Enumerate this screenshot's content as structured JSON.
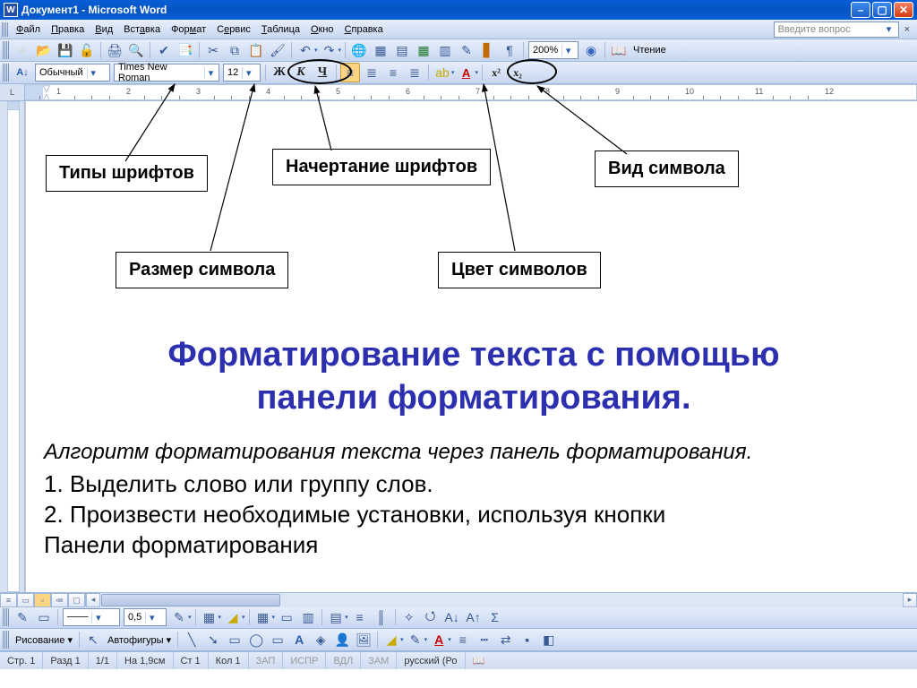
{
  "titlebar": {
    "title": "Документ1 - Microsoft Word"
  },
  "menu": {
    "items": [
      "Файл",
      "Правка",
      "Вид",
      "Вставка",
      "Формат",
      "Сервис",
      "Таблица",
      "Окно",
      "Справка"
    ],
    "question_placeholder": "Введите вопрос"
  },
  "toolbar1": {
    "zoom": "200%",
    "read_label": "Чтение"
  },
  "toolbar2": {
    "style": "Обычный",
    "font": "Times New Roman",
    "size": "12",
    "bold": "Ж",
    "italic": "К",
    "underline": "Ч",
    "sup": "x²",
    "sub": "x₂"
  },
  "ruler": {
    "numbers": [
      "1",
      "2",
      "3",
      "4",
      "5",
      "6",
      "7",
      "8",
      "9",
      "10",
      "11",
      "12"
    ]
  },
  "annotations": {
    "font_types": "Типы шрифтов",
    "font_style": "Начертание шрифтов",
    "symbol_kind": "Вид символа",
    "symbol_size": "Размер символа",
    "symbol_color": "Цвет символов"
  },
  "document": {
    "heading_line1": "Форматирование текста с помощью",
    "heading_line2": "панели форматирования.",
    "subtitle": "Алгоритм форматирования текста через панель форматирования.",
    "line1": "1. Выделить слово или группу слов.",
    "line2": "2. Произвести необходимые установки, используя кнопки",
    "line3": "Панели форматирования"
  },
  "bottom_toolbar": {
    "line_weight": "0,5"
  },
  "drawbar": {
    "label": "Рисование",
    "autoshapes": "Автофигуры"
  },
  "status": {
    "page": "Стр. 1",
    "section": "Разд 1",
    "pages": "1/1",
    "at": "На 1,9см",
    "line": "Ст 1",
    "col": "Кол 1",
    "rec": "ЗАП",
    "fix": "ИСПР",
    "ext": "ВДЛ",
    "ovr": "ЗАМ",
    "lang": "русский (Ро"
  }
}
